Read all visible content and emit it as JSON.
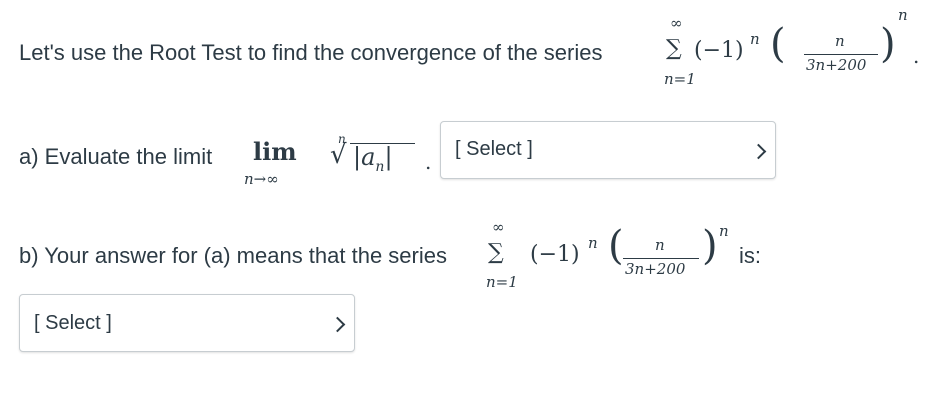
{
  "question": {
    "intro_text": "Let's use the Root Test to find the convergence of the series",
    "series": {
      "sum_upper": "∞",
      "sum_lower": "n=1",
      "base": "(−1)",
      "exponent": "n",
      "frac_num": "n",
      "frac_den": "3n+200",
      "outer_exponent": "n",
      "end_punct": "."
    }
  },
  "part_a": {
    "text": "a) Evaluate the limit",
    "lim": "lim",
    "lim_sub": "n→∞",
    "root_index": "n",
    "radicand": "|a",
    "radicand_sub": "n",
    "radicand_end": "|",
    "end_punct": ".",
    "select_value": "[ Select ]"
  },
  "part_b": {
    "text": "b) Your answer for (a) means that the series",
    "suffix": "is:",
    "select_value": "[ Select ]"
  }
}
